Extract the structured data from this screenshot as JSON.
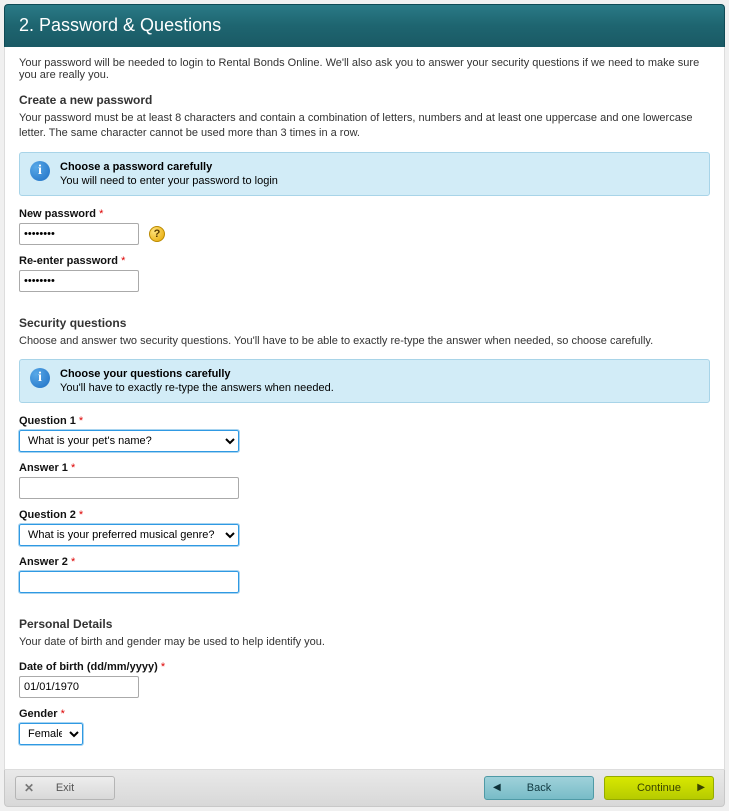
{
  "header": {
    "title": "2. Password & Questions"
  },
  "intro": "Your password will be needed to login to Rental Bonds Online. We'll also ask you to answer your security questions if we need to make sure you are really you.",
  "password_section": {
    "heading": "Create a new password",
    "desc": "Your password must be at least 8 characters and contain a combination of letters, numbers and at least one uppercase and one lowercase letter. The same character cannot be used more than 3 times in a row.",
    "info_title": "Choose a password carefully",
    "info_body": "You will need to enter your password to login",
    "new_pw_label": "New password",
    "new_pw_value": "••••••••",
    "help_tooltip": "?",
    "re_pw_label": "Re-enter password",
    "re_pw_value": "••••••••"
  },
  "security_section": {
    "heading": "Security questions",
    "desc": "Choose and answer two security questions. You'll have to be able to exactly re-type the answer when needed, so choose carefully.",
    "info_title": "Choose your questions carefully",
    "info_body": "You'll have to exactly re-type the answers when needed.",
    "q1_label": "Question 1",
    "q1_value": "What is your pet's name?",
    "a1_label": "Answer 1",
    "a1_value": "",
    "q2_label": "Question 2",
    "q2_value": "What is your preferred musical genre?",
    "a2_label": "Answer 2",
    "a2_value": ""
  },
  "personal_section": {
    "heading": "Personal Details",
    "desc": "Your date of birth and gender may be used to help identify you.",
    "dob_label": "Date of birth (dd/mm/yyyy)",
    "dob_value": "01/01/1970",
    "gender_label": "Gender",
    "gender_value": "Female"
  },
  "footer": {
    "exit": "Exit",
    "back": "Back",
    "continue": "Continue"
  },
  "required_marker": "*"
}
